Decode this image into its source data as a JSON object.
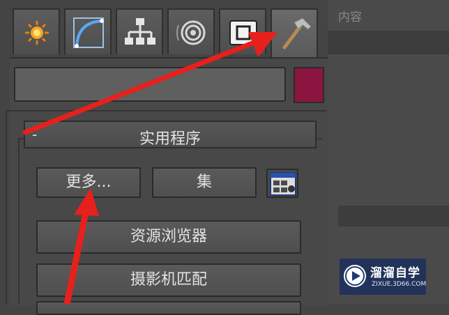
{
  "right_panel": {
    "partial_label": "内容"
  },
  "tabs": [
    {
      "id": "create",
      "icon": "create-star-icon"
    },
    {
      "id": "modify",
      "icon": "modify-curve-icon"
    },
    {
      "id": "hierarchy",
      "icon": "hierarchy-icon"
    },
    {
      "id": "motion",
      "icon": "motion-icon"
    },
    {
      "id": "display",
      "icon": "display-icon"
    },
    {
      "id": "utilities",
      "icon": "hammer-icon",
      "active": true
    }
  ],
  "object": {
    "name_value": "",
    "color": "#8c1540"
  },
  "rollout": {
    "toggle": "-",
    "title": "实用程序",
    "buttons": {
      "more": "更多...",
      "sets": "集",
      "configure_icon": "configure-button-sets-icon",
      "asset_browser": "资源浏览器",
      "camera_match": "摄影机匹配"
    }
  },
  "annotations": {
    "arrow_color": "#e8201c"
  },
  "watermark": {
    "title": "溜溜自学",
    "subtitle": "ZIXUE.3D66.COM"
  }
}
